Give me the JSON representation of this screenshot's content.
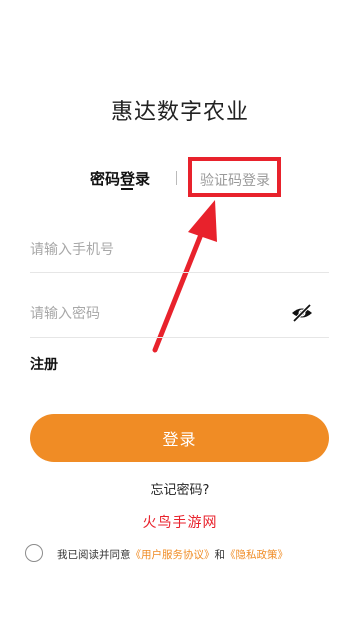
{
  "app": {
    "title": "惠达数字农业"
  },
  "tabs": [
    {
      "label": "密码登录",
      "active": true
    },
    {
      "label": "验证码登录",
      "active": false
    }
  ],
  "form": {
    "phone_placeholder": "请输入手机号",
    "phone_value": "",
    "password_placeholder": "请输入密码",
    "password_value": ""
  },
  "actions": {
    "register_label": "注册",
    "login_label": "登录",
    "forgot_label": "忘记密码?"
  },
  "watermark": "火鸟手游网",
  "agreement": {
    "checked": false,
    "prefix": "我已阅读并同意",
    "user_agreement": "《用户服务协议》",
    "and": "和",
    "privacy_policy": "《隐私政策》"
  },
  "colors": {
    "accent": "#f08c25",
    "annotation_red": "#e8222c"
  },
  "icons": {
    "password_visibility": "eye-off-icon"
  }
}
